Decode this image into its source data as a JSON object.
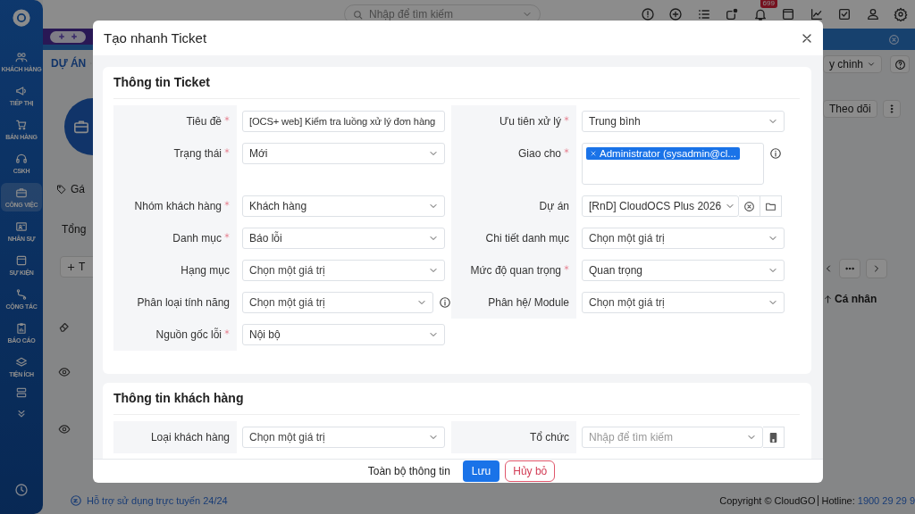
{
  "sidebar": {
    "items": [
      {
        "label": "KHÁCH HÀNG",
        "selected": false
      },
      {
        "label": "TIẾP THỊ",
        "selected": false
      },
      {
        "label": "BÁN HÀNG",
        "selected": false
      },
      {
        "label": "CSKH",
        "selected": false
      },
      {
        "label": "CÔNG VIỆC",
        "selected": true
      },
      {
        "label": "NHÂN SỰ",
        "selected": false
      },
      {
        "label": "SỰ KIỆN",
        "selected": false
      },
      {
        "label": "CỘNG TÁC",
        "selected": false
      },
      {
        "label": "BÁO CÁO",
        "selected": false
      },
      {
        "label": "TIỆN ÍCH",
        "selected": false
      }
    ]
  },
  "topbar": {
    "search": {
      "placeholder": "Nhập để tìm kiếm"
    },
    "notification_badge": "699"
  },
  "page": {
    "breadcrumb": "DỰ ÁN",
    "tag_label": "Gá",
    "total_label": "Tổng",
    "add_button": "T",
    "view_button": "y chinh",
    "follow_button": "Theo dõi",
    "sort_label": "Cá nhân"
  },
  "footer": {
    "support": "Hỗ trợ sử dụng trực tuyến 24/24",
    "copyright": "Copyright © CloudGO",
    "hotline_label": "Hotline:",
    "hotline": "1900 29 29 9"
  },
  "modal": {
    "title": "Tạo nhanh Ticket",
    "sections": [
      {
        "title": "Thông tin Ticket",
        "rows": [
          {
            "left": {
              "label": "Tiêu đề",
              "required": true,
              "kind": "text",
              "value": "[OCS+ web] Kiểm tra luồng xử lý đơn hàng"
            },
            "right": {
              "label": "Ưu tiên xử lý",
              "required": true,
              "kind": "select",
              "value": "Trung bình"
            }
          },
          {
            "left": {
              "label": "Trạng thái",
              "required": true,
              "kind": "select",
              "value": "Mới"
            },
            "right": {
              "label": "Giao cho",
              "required": true,
              "kind": "multi",
              "tags": [
                "Administrator (sysadmin@cl..."
              ],
              "info": true
            }
          },
          {
            "left": {
              "label": "Nhóm khách hàng",
              "required": true,
              "kind": "select",
              "value": "Khách hàng"
            },
            "right": {
              "label": "Dự án",
              "required": false,
              "kind": "select",
              "value": "[RnD] CloudOCS Plus 2026",
              "actions": [
                {
                  "kind": "clear"
                },
                {
                  "kind": "folder"
                }
              ]
            }
          },
          {
            "left": {
              "label": "Danh mục",
              "required": true,
              "kind": "select",
              "value": "Báo lỗi"
            },
            "right": {
              "label": "Chi tiết danh mục",
              "required": false,
              "kind": "select",
              "placeholder": "Chọn một giá trị"
            }
          },
          {
            "left": {
              "label": "Hạng mục",
              "required": false,
              "kind": "select",
              "placeholder": "Chọn một giá trị"
            },
            "right": {
              "label": "Mức độ quan trọng",
              "required": true,
              "kind": "select",
              "value": "Quan trọng"
            }
          },
          {
            "left": {
              "label": "Phân loại tính năng",
              "required": false,
              "kind": "select",
              "placeholder": "Chọn một giá trị",
              "info": true
            },
            "right": {
              "label": "Phân hệ/ Module",
              "required": false,
              "kind": "select",
              "placeholder": "Chọn một giá trị"
            }
          },
          {
            "left": {
              "label": "Nguồn gốc lỗi",
              "required": true,
              "kind": "select",
              "value": "Nội bộ"
            }
          }
        ]
      },
      {
        "title": "Thông tin khách hàng",
        "rows": [
          {
            "left": {
              "label": "Loại khách hàng",
              "required": false,
              "kind": "select",
              "placeholder": "Chọn một giá trị"
            },
            "right": {
              "label": "Tổ chức",
              "required": false,
              "kind": "search",
              "placeholder": "Nhập để tìm kiếm",
              "actions": [
                {
                  "kind": "building"
                }
              ]
            }
          }
        ]
      }
    ],
    "buttons": [
      {
        "label": "Toàn bộ thông tin",
        "kind": "default"
      },
      {
        "label": "Lưu",
        "kind": "primary"
      },
      {
        "label": "Hủy bỏ",
        "kind": "danger"
      }
    ]
  }
}
